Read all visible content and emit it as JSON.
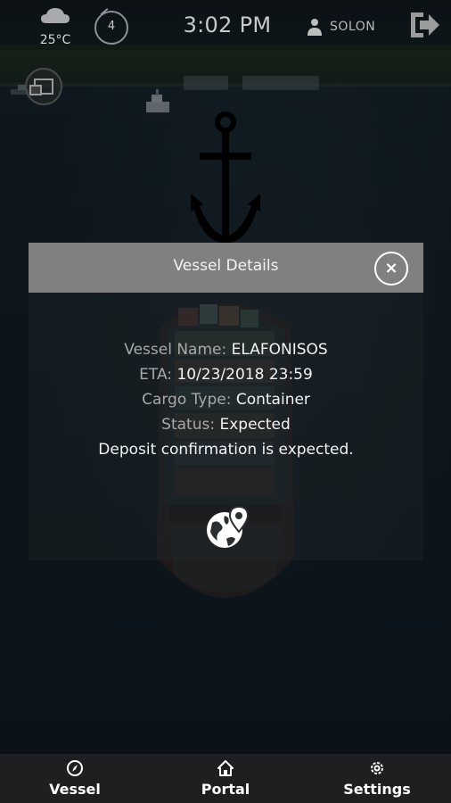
{
  "status_bar": {
    "temperature": "25°C",
    "weather_icon": "cloud-icon",
    "compass_value": "4",
    "time": "3:02 PM",
    "user_icon": "person-icon",
    "username": "SOLON",
    "logout_icon": "logout-arrow-icon"
  },
  "modal": {
    "title": "Vessel Details",
    "close_label": "×",
    "fields": [
      {
        "label": "Vessel Name:",
        "value": "ELAFONISOS"
      },
      {
        "label": "ETA:",
        "value": "10/23/2018 23:59"
      },
      {
        "label": "Cargo Type:",
        "value": "Container"
      },
      {
        "label": "Status:",
        "value": "Expected"
      }
    ],
    "note": "Deposit confirmation is expected.",
    "map_icon": "globe-location-icon"
  },
  "bottom_nav": {
    "items": [
      {
        "label": "Vessel",
        "icon": "compass-icon"
      },
      {
        "label": "Portal",
        "icon": "home-icon"
      },
      {
        "label": "Settings",
        "icon": "gear-icon"
      }
    ]
  },
  "colors": {
    "modal_header": "#808080",
    "nav_bg": "#1d1f21",
    "label_gray": "#a8a8a8",
    "value_white": "#f2f2f2"
  }
}
